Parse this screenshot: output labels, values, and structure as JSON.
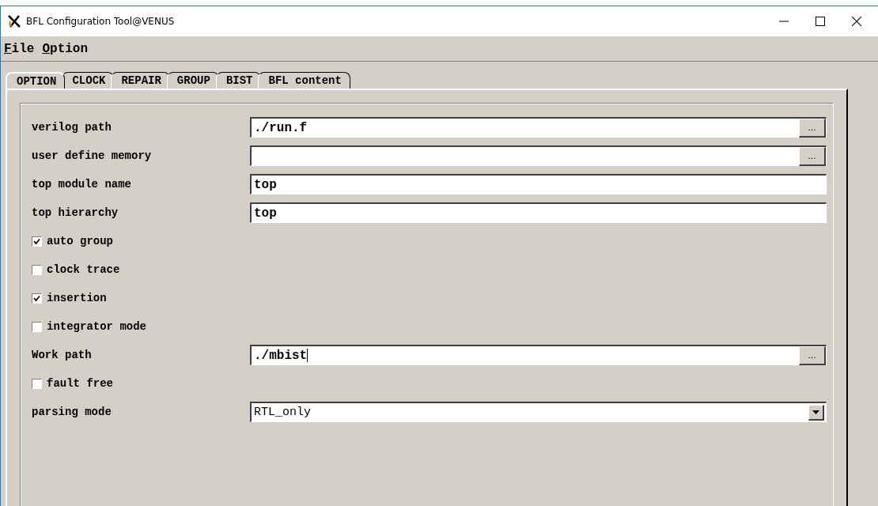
{
  "window": {
    "title": "BFL Configuration Tool@VENUS"
  },
  "menu": [
    {
      "label": "File"
    },
    {
      "label": "Option"
    }
  ],
  "tabs": [
    {
      "label": "OPTION",
      "selected": true
    },
    {
      "label": "CLOCK",
      "selected": false
    },
    {
      "label": "REPAIR",
      "selected": false
    },
    {
      "label": "GROUP",
      "selected": false
    },
    {
      "label": "BIST",
      "selected": false
    },
    {
      "label": "BFL content",
      "selected": false
    }
  ],
  "rows": [
    {
      "kind": "field",
      "label": "verilog path",
      "value": "./run.f",
      "browse": "..."
    },
    {
      "kind": "field",
      "label": "user define memory",
      "browse": "..."
    },
    {
      "kind": "field",
      "label": "top module name",
      "value": "top"
    },
    {
      "kind": "field",
      "label": "top hierarchy",
      "value": "top"
    },
    {
      "kind": "checkbox",
      "label": "auto group",
      "checked": true
    },
    {
      "kind": "checkbox",
      "label": "clock trace",
      "checked": false
    },
    {
      "kind": "checkbox",
      "label": "insertion",
      "checked": true
    },
    {
      "kind": "checkbox",
      "label": "integrator mode",
      "checked": false
    },
    {
      "kind": "field",
      "label": "Work path",
      "value": "./mbist",
      "browse": "...",
      "focused": true
    },
    {
      "kind": "checkbox",
      "label": "fault free",
      "checked": false
    },
    {
      "kind": "select",
      "label": "parsing mode",
      "value": "RTL_only"
    }
  ]
}
